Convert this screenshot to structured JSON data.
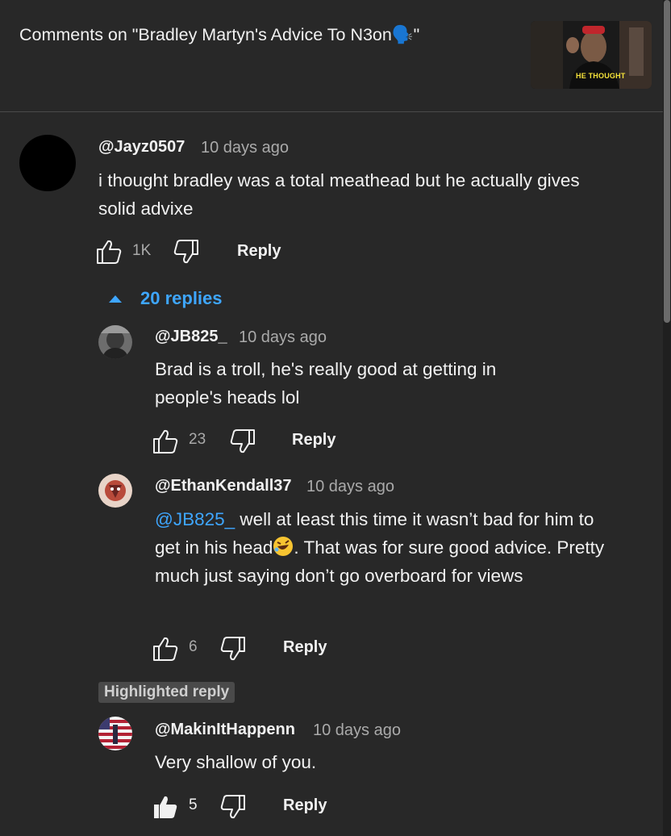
{
  "header": {
    "title": "Comments on \"Bradley Martyn's Advice To N3on🗣️\"",
    "thumbnail_caption": "HE THOUGHT"
  },
  "comments": [
    {
      "handle": "@Jayz0507",
      "time": "10 days ago",
      "text": "i thought bradley was a total meathead but he actually gives solid advixe",
      "likes": "1K",
      "reply_label": "Reply",
      "replies_toggle": "20 replies"
    }
  ],
  "replies": [
    {
      "handle": "@JB825_",
      "time": "10 days ago",
      "text": "Brad is a troll, he's really good at getting in people's heads lol",
      "likes": "23",
      "reply_label": "Reply"
    },
    {
      "handle": "@EthanKendall37",
      "time": "10 days ago",
      "mention": "@JB825_",
      "text_a": " well at least this time it wasn’t bad for him to get in his head",
      "text_b": ". That was for sure good advice. Pretty much just saying don’t go overboard for views",
      "likes": "6",
      "reply_label": "Reply"
    },
    {
      "badge": "Highlighted reply",
      "handle": "@MakinItHappenn",
      "time": "10 days ago",
      "text": "Very shallow of you.",
      "likes": "5",
      "reply_label": "Reply",
      "liked": true
    }
  ],
  "colors": {
    "background": "#282828",
    "link": "#3ea6ff",
    "muted": "#aaaaaa"
  }
}
